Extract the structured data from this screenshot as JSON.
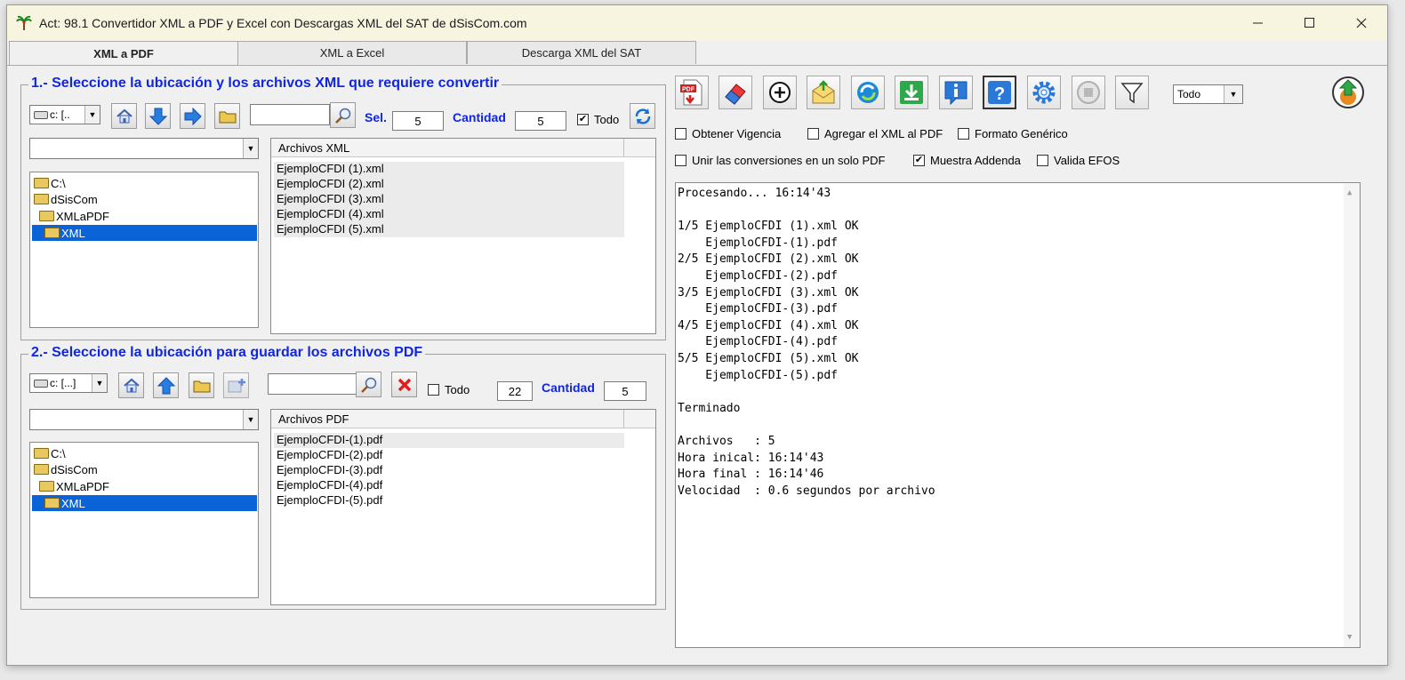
{
  "window": {
    "title": "Act: 98.1  Convertidor XML a PDF y Excel con Descargas XML del SAT de dSisCom.com",
    "controls": [
      "minimize",
      "maximize",
      "close"
    ]
  },
  "tabs": [
    {
      "label": "XML a PDF",
      "active": true
    },
    {
      "label": "XML a Excel",
      "active": false
    },
    {
      "label": "Descarga XML del SAT",
      "active": false
    }
  ],
  "section1": {
    "legend": "1.- Seleccione la ubicación y los archivos XML que requiere convertir",
    "drive": "c: [..",
    "search_value": "",
    "sel_label": "Sel.",
    "sel_value": "5",
    "cantidad_label": "Cantidad",
    "cantidad_value": "5",
    "todo_label": "Todo",
    "todo_checked": true,
    "filter_combo": "",
    "tree": [
      "C:\\",
      "dSisCom",
      "XMLaPDF",
      "XML"
    ],
    "list_header": "Archivos XML",
    "files": [
      "EjemploCFDI (1).xml",
      "EjemploCFDI (2).xml",
      "EjemploCFDI (3).xml",
      "EjemploCFDI (4).xml",
      "EjemploCFDI (5).xml"
    ]
  },
  "section2": {
    "legend": "2.- Seleccione la ubicación para guardar los archivos PDF",
    "drive": "c: [...]",
    "search_value": "",
    "todo_label": "Todo",
    "todo_checked": false,
    "count_value": "22",
    "cantidad_label": "Cantidad",
    "cantidad_value": "5",
    "filter_combo": "",
    "tree": [
      "C:\\",
      "dSisCom",
      "XMLaPDF",
      "XML"
    ],
    "list_header": "Archivos PDF",
    "files": [
      "EjemploCFDI-(1).pdf",
      "EjemploCFDI-(2).pdf",
      "EjemploCFDI-(3).pdf",
      "EjemploCFDI-(4).pdf",
      "EjemploCFDI-(5).pdf"
    ]
  },
  "right_panel": {
    "toolbar_icons": [
      "pdf-convert-icon",
      "eraser-icon",
      "add-circle-icon",
      "open-mail-icon",
      "refresh-icon",
      "download-icon",
      "info-icon",
      "help-icon",
      "settings-gear-icon",
      "stop-icon",
      "filter-icon"
    ],
    "filter_combo": "Todo",
    "options": {
      "obtener_vigencia": {
        "label": "Obtener Vigencia",
        "checked": false
      },
      "agregar_xml": {
        "label": "Agregar el XML al PDF",
        "checked": false
      },
      "formato_generico": {
        "label": "Formato Genérico",
        "checked": false
      },
      "unir": {
        "label": "Unir las conversiones en un solo PDF",
        "checked": false
      },
      "muestra_addenda": {
        "label": "Muestra Addenda",
        "checked": true
      },
      "valida_efos": {
        "label": "Valida EFOS",
        "checked": false
      }
    },
    "log_lines": [
      "Procesando... 16:14'43",
      "",
      "1/5 EjemploCFDI (1).xml OK",
      "    EjemploCFDI-(1).pdf",
      "2/5 EjemploCFDI (2).xml OK",
      "    EjemploCFDI-(2).pdf",
      "3/5 EjemploCFDI (3).xml OK",
      "    EjemploCFDI-(3).pdf",
      "4/5 EjemploCFDI (4).xml OK",
      "    EjemploCFDI-(4).pdf",
      "5/5 EjemploCFDI (5).xml OK",
      "    EjemploCFDI-(5).pdf",
      "",
      "Terminado",
      "",
      "Archivos   : 5",
      "Hora inical: 16:14'43",
      "Hora final : 16:14'46",
      "Velocidad  : 0.6 segundos por archivo"
    ]
  },
  "colors": {
    "accent_blue": "#1026e0",
    "selection": "#0a64d8",
    "titlebar": "#f7f4df"
  }
}
